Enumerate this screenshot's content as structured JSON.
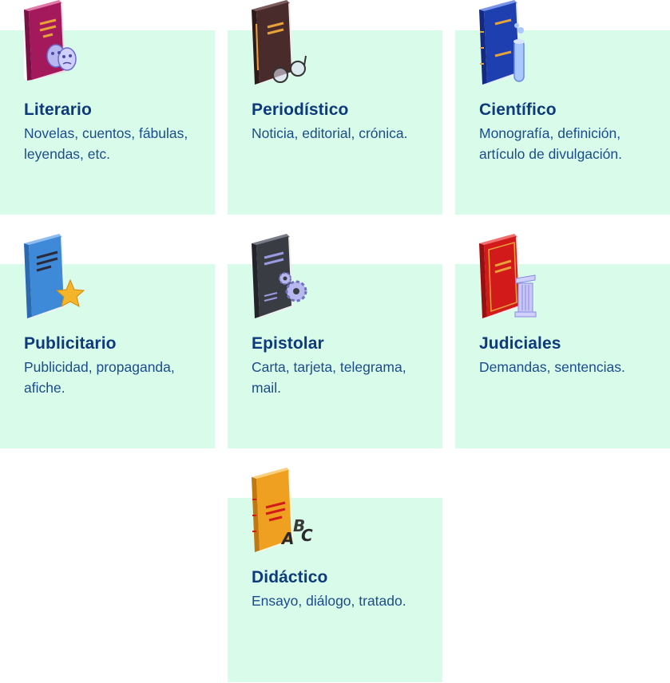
{
  "cards": [
    {
      "title": "Literario",
      "description": "Novelas, cuentos, fábulas, leyendas, etc.",
      "icon": "theater-masks-book-icon",
      "cover": "#a3195b"
    },
    {
      "title": "Periodístico",
      "description": "Noticia, editorial, crónica.",
      "icon": "glasses-book-icon",
      "cover": "#4a2b2b"
    },
    {
      "title": "Científico",
      "description": "Monografía, definición, artículo de divulgación.",
      "icon": "test-tube-book-icon",
      "cover": "#1e3fb0"
    },
    {
      "title": "Publicitario",
      "description": "Publicidad, propaganda, afiche.",
      "icon": "star-book-icon",
      "cover": "#3f8ad8"
    },
    {
      "title": "Epistolar",
      "description": "Carta, tarjeta, telegrama, mail.",
      "icon": "gears-book-icon",
      "cover": "#3a3c44"
    },
    {
      "title": "Judiciales",
      "description": "Demandas, sentencias.",
      "icon": "column-book-icon",
      "cover": "#d21a1a"
    },
    {
      "title": "Didáctico",
      "description": "Ensayo, diálogo, tratado.",
      "icon": "abc-book-icon",
      "cover": "#f0a020"
    }
  ],
  "colors": {
    "card_background": "#d9fbea",
    "title": "#0d3a7a",
    "description": "#1b4c8c"
  }
}
